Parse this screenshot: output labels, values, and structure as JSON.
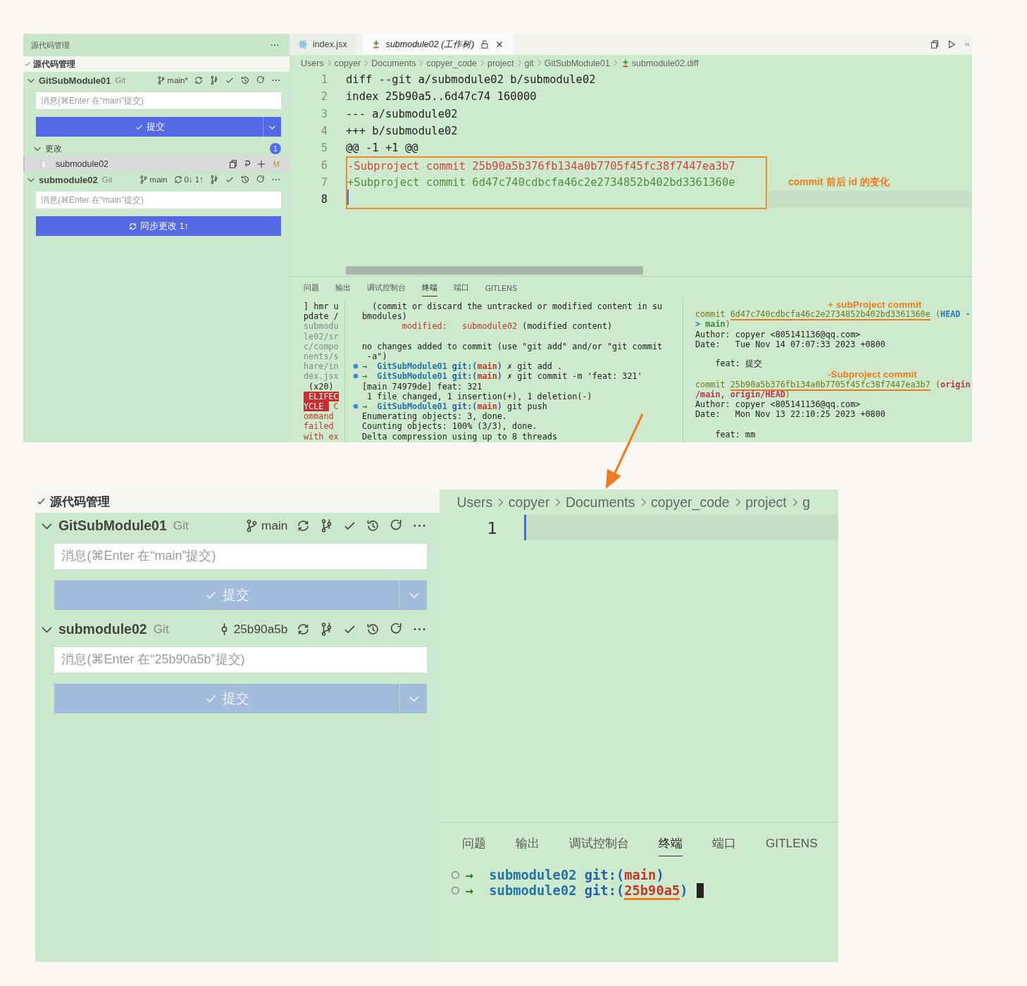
{
  "screens": [
    {
      "sidebar": {
        "title": "源代码管理",
        "section": "源代码管理",
        "repos": [
          {
            "name": "GitSubModule01",
            "provider": "Git",
            "kind": "branch",
            "ref": "main*",
            "placeholder": "消息(⌘Enter 在“main”提交)",
            "button": {
              "kind": "commit",
              "label": "提交",
              "disabled": false,
              "dropdown": true
            },
            "changes": {
              "label": "更改",
              "count": "1",
              "files": [
                {
                  "name": "submodule02",
                  "status": "M",
                  "selected": true
                }
              ]
            }
          },
          {
            "name": "submodule02",
            "provider": "Git",
            "kind": "branch",
            "ref": "main",
            "sync": "0↓ 1↑",
            "placeholder": "消息(⌘Enter 在“main”提交)",
            "button": {
              "kind": "sync",
              "label": "同步更改 1↑",
              "disabled": false,
              "dropdown": false
            }
          }
        ]
      },
      "editor": {
        "tabs": [
          {
            "label": "index.jsx",
            "selected": false,
            "preview": false
          },
          {
            "label": "submodule02 (工作树)",
            "selected": true,
            "preview": true
          }
        ],
        "breadcrumbs": [
          {
            "label": "Users",
            "kind": "folder"
          },
          {
            "label": "copyer",
            "kind": "folder"
          },
          {
            "label": "Documents",
            "kind": "folder"
          },
          {
            "label": "copyer_code",
            "kind": "folder"
          },
          {
            "label": "project",
            "kind": "folder"
          },
          {
            "label": "git",
            "kind": "folder"
          },
          {
            "label": "GitSubModule01",
            "kind": "folder"
          },
          {
            "label": "submodule02.diff",
            "kind": "file"
          }
        ],
        "lines": [
          {
            "number": "1",
            "kind": "context",
            "text": "diff --git a/submodule02 b/submodule02",
            "current": false,
            "boxed": false
          },
          {
            "number": "2",
            "kind": "context",
            "text": "index 25b90a5..6d47c74 160000",
            "current": false,
            "boxed": false
          },
          {
            "number": "3",
            "kind": "context",
            "text": "--- a/submodule02",
            "current": false,
            "boxed": false
          },
          {
            "number": "4",
            "kind": "context",
            "text": "+++ b/submodule02",
            "current": false,
            "boxed": false
          },
          {
            "number": "5",
            "kind": "context",
            "text": "@@ -1 +1 @@",
            "current": false,
            "boxed": false
          },
          {
            "number": "6",
            "kind": "removed",
            "text": "-Subproject commit 25b90a5b376fb134a0b7705f45fc38f7447ea3b7",
            "current": false,
            "boxed": true
          },
          {
            "number": "7",
            "kind": "added",
            "text": "+Subproject commit 6d47c740cdbcfa46c2e2734852b402bd3361360e",
            "current": false,
            "boxed": true,
            "note": "commit 前后 id 的变化"
          },
          {
            "number": "8",
            "kind": "context",
            "current": true,
            "boxed": true
          }
        ]
      },
      "panel": {
        "tabs": [
          {
            "label": "问题",
            "selected": false
          },
          {
            "label": "输出",
            "selected": false
          },
          {
            "label": "调试控制台",
            "selected": false
          },
          {
            "label": "终端",
            "selected": true
          },
          {
            "label": "端口",
            "selected": false
          },
          {
            "label": "GITLENS",
            "selected": false
          }
        ],
        "panes": [
          {
            "kind": "side",
            "lines": [
              {
                "kind": "text",
                "segments": [
                  {
                    "text": "] hmr u",
                    "kind": "plain"
                  }
                ]
              },
              {
                "kind": "text",
                "segments": [
                  {
                    "text": "pdate /",
                    "kind": "plain"
                  }
                ]
              },
              {
                "kind": "text",
                "segments": [
                  {
                    "text": "submodu",
                    "kind": "dim"
                  }
                ]
              },
              {
                "kind": "text",
                "segments": [
                  {
                    "text": "le02/sr",
                    "kind": "dim"
                  }
                ]
              },
              {
                "kind": "text",
                "segments": [
                  {
                    "text": "c/compo",
                    "kind": "dim"
                  }
                ]
              },
              {
                "kind": "text",
                "segments": [
                  {
                    "text": "nents/s",
                    "kind": "dim"
                  }
                ]
              },
              {
                "kind": "text",
                "segments": [
                  {
                    "text": "hare/in",
                    "kind": "dim"
                  }
                ]
              },
              {
                "kind": "text",
                "segments": [
                  {
                    "text": "dex.jsx",
                    "kind": "dim"
                  }
                ]
              },
              {
                "kind": "text",
                "segments": [
                  {
                    "text": " (x20)",
                    "kind": "plain"
                  }
                ]
              },
              {
                "kind": "text",
                "segments": [
                  {
                    "text": " ELIFEC",
                    "kind": "badge"
                  }
                ]
              },
              {
                "kind": "text",
                "segments": [
                  {
                    "text": "YCLE ",
                    "kind": "badge"
                  },
                  {
                    "text": " C",
                    "kind": "red"
                  }
                ]
              },
              {
                "kind": "text",
                "segments": [
                  {
                    "text": "ommand",
                    "kind": "red"
                  }
                ]
              },
              {
                "kind": "text",
                "segments": [
                  {
                    "text": "failed",
                    "kind": "red"
                  }
                ]
              },
              {
                "kind": "text",
                "segments": [
                  {
                    "text": "with ex",
                    "kind": "red"
                  }
                ]
              }
            ]
          },
          {
            "kind": "main",
            "lines": [
              {
                "kind": "text",
                "segments": [
                  {
                    "text": "  (commit or discard the untracked or modified content in su",
                    "kind": "plain"
                  }
                ]
              },
              {
                "kind": "text",
                "segments": [
                  {
                    "text": "bmodules)",
                    "kind": "plain"
                  }
                ]
              },
              {
                "kind": "text",
                "segments": [
                  {
                    "text": "        modified:   submodule02",
                    "kind": "red"
                  },
                  {
                    "text": " (modified content)",
                    "kind": "plain"
                  }
                ]
              },
              {
                "kind": "blank"
              },
              {
                "kind": "text",
                "segments": [
                  {
                    "text": "no changes added to commit (use \"git add\" and/or \"git commit",
                    "kind": "plain"
                  }
                ]
              },
              {
                "kind": "text",
                "segments": [
                  {
                    "text": " -a\")",
                    "kind": "plain"
                  }
                ]
              },
              {
                "kind": "prompt",
                "succeeded": true,
                "cursor": false,
                "segments": [
                  {
                    "text": "→  ",
                    "kind": "arrow"
                  },
                  {
                    "text": "GitSubModule01 ",
                    "kind": "dir"
                  },
                  {
                    "text": "git:(",
                    "kind": "git"
                  },
                  {
                    "text": "main",
                    "kind": "branch"
                  },
                  {
                    "text": ") ",
                    "kind": "git"
                  },
                  {
                    "text": "✗ git add .",
                    "kind": "plain"
                  }
                ]
              },
              {
                "kind": "prompt",
                "succeeded": true,
                "cursor": false,
                "segments": [
                  {
                    "text": "→  ",
                    "kind": "arrow"
                  },
                  {
                    "text": "GitSubModule01 ",
                    "kind": "dir"
                  },
                  {
                    "text": "git:(",
                    "kind": "git"
                  },
                  {
                    "text": "main",
                    "kind": "branch"
                  },
                  {
                    "text": ") ",
                    "kind": "git"
                  },
                  {
                    "text": "✗ git commit -m 'feat: 321'",
                    "kind": "plain"
                  }
                ]
              },
              {
                "kind": "text",
                "segments": [
                  {
                    "text": "[main 74979de] feat: 321",
                    "kind": "plain"
                  }
                ]
              },
              {
                "kind": "text",
                "segments": [
                  {
                    "text": " 1 file changed, 1 insertion(+), 1 deletion(-)",
                    "kind": "plain"
                  }
                ]
              },
              {
                "kind": "prompt",
                "succeeded": true,
                "cursor": false,
                "segments": [
                  {
                    "text": "→  ",
                    "kind": "arrow"
                  },
                  {
                    "text": "GitSubModule01 ",
                    "kind": "dir"
                  },
                  {
                    "text": "git:(",
                    "kind": "git"
                  },
                  {
                    "text": "main",
                    "kind": "branch"
                  },
                  {
                    "text": ") ",
                    "kind": "git"
                  },
                  {
                    "text": "git push",
                    "kind": "plain"
                  }
                ]
              },
              {
                "kind": "text",
                "segments": [
                  {
                    "text": "Enumerating objects: 3, done.",
                    "kind": "plain"
                  }
                ]
              },
              {
                "kind": "text",
                "segments": [
                  {
                    "text": "Counting objects: 100% (3/3), done.",
                    "kind": "plain"
                  }
                ]
              },
              {
                "kind": "text",
                "segments": [
                  {
                    "text": "Delta compression using up to 8 threads",
                    "kind": "plain"
                  }
                ]
              }
            ]
          },
          {
            "kind": "log",
            "lines": [
              {
                "kind": "note",
                "segments": [
                  {
                    "text": "+ subProject commit",
                    "kind": "note"
                  }
                ]
              },
              {
                "kind": "text",
                "segments": [
                  {
                    "text": "commit ",
                    "kind": "hash"
                  },
                  {
                    "text": "6d47c740cdbcfa46c2e2734852b402bd3361360e",
                    "kind": "hash",
                    "marked": true
                  },
                  {
                    "text": " (",
                    "kind": "hash"
                  },
                  {
                    "text": "HEAD -",
                    "kind": "head"
                  }
                ]
              },
              {
                "kind": "text",
                "segments": [
                  {
                    "text": "> ",
                    "kind": "head"
                  },
                  {
                    "text": "main",
                    "kind": "local"
                  },
                  {
                    "text": ")",
                    "kind": "hash"
                  }
                ]
              },
              {
                "kind": "text",
                "segments": [
                  {
                    "text": "Author: copyer <805141136@qq.com>",
                    "kind": "plain"
                  }
                ]
              },
              {
                "kind": "text",
                "segments": [
                  {
                    "text": "Date:   Tue Nov 14 07:07:33 2023 +0800",
                    "kind": "plain"
                  }
                ]
              },
              {
                "kind": "blank"
              },
              {
                "kind": "text",
                "segments": [
                  {
                    "text": "    feat: 提交",
                    "kind": "plain"
                  }
                ]
              },
              {
                "kind": "note",
                "segments": [
                  {
                    "text": "-Subproject commit",
                    "kind": "note"
                  }
                ]
              },
              {
                "kind": "text",
                "segments": [
                  {
                    "text": "commit ",
                    "kind": "hash"
                  },
                  {
                    "text": "25b90a5b376fb134a0b7705f45fc38f7447ea3b7",
                    "kind": "hash",
                    "marked": true
                  },
                  {
                    "text": " (",
                    "kind": "hash"
                  },
                  {
                    "text": "origin",
                    "kind": "remote"
                  }
                ]
              },
              {
                "kind": "text",
                "segments": [
                  {
                    "text": "/main, origin/HEAD",
                    "kind": "remote"
                  },
                  {
                    "text": ")",
                    "kind": "hash"
                  }
                ]
              },
              {
                "kind": "text",
                "segments": [
                  {
                    "text": "Author: copyer <805141136@qq.com>",
                    "kind": "plain"
                  }
                ]
              },
              {
                "kind": "text",
                "segments": [
                  {
                    "text": "Date:   Mon Nov 13 22:10:25 2023 +0800",
                    "kind": "plain"
                  }
                ]
              },
              {
                "kind": "blank"
              },
              {
                "kind": "text",
                "segments": [
                  {
                    "text": "    feat: mm",
                    "kind": "plain"
                  }
                ]
              }
            ]
          }
        ]
      }
    },
    {
      "sidebar": {
        "section": "源代码管理",
        "repos": [
          {
            "name": "GitSubModule01",
            "provider": "Git",
            "kind": "branch",
            "ref": "main",
            "placeholder": "消息(⌘Enter 在“main”提交)",
            "button": {
              "kind": "commit",
              "label": "提交",
              "disabled": true,
              "dropdown": true
            }
          },
          {
            "name": "submodule02",
            "provider": "Git",
            "kind": "commit",
            "ref": "25b90a5b",
            "placeholder": "消息(⌘Enter 在“25b90a5b”提交)",
            "button": {
              "kind": "commit",
              "label": "提交",
              "disabled": true,
              "dropdown": true
            }
          }
        ]
      },
      "editor": {
        "breadcrumbs": [
          {
            "label": "Users",
            "kind": "folder"
          },
          {
            "label": "copyer",
            "kind": "folder"
          },
          {
            "label": "Documents",
            "kind": "folder"
          },
          {
            "label": "copyer_code",
            "kind": "folder"
          },
          {
            "label": "project",
            "kind": "folder"
          },
          {
            "label": "g",
            "kind": "folder"
          }
        ],
        "lines": [
          {
            "number": "1",
            "kind": "context",
            "current": true,
            "boxed": false
          }
        ]
      },
      "panel": {
        "tabs": [
          {
            "label": "问题",
            "selected": false
          },
          {
            "label": "输出",
            "selected": false
          },
          {
            "label": "调试控制台",
            "selected": false
          },
          {
            "label": "终端",
            "selected": true
          },
          {
            "label": "端口",
            "selected": false
          },
          {
            "label": "GITLENS",
            "selected": false
          }
        ],
        "panes": [
          {
            "kind": "main",
            "lines": [
              {
                "kind": "prompt",
                "succeeded": false,
                "cursor": false,
                "segments": [
                  {
                    "text": "→  ",
                    "kind": "arrow"
                  },
                  {
                    "text": "submodule02 ",
                    "kind": "dir"
                  },
                  {
                    "text": "git:(",
                    "kind": "git"
                  },
                  {
                    "text": "main",
                    "kind": "branch"
                  },
                  {
                    "text": ")",
                    "kind": "git"
                  }
                ]
              },
              {
                "kind": "prompt",
                "succeeded": false,
                "cursor": true,
                "segments": [
                  {
                    "text": "→  ",
                    "kind": "arrow"
                  },
                  {
                    "text": "submodule02 ",
                    "kind": "dir"
                  },
                  {
                    "text": "git:(",
                    "kind": "git"
                  },
                  {
                    "text": "25b90a5",
                    "kind": "branch",
                    "marked": true
                  },
                  {
                    "text": ")",
                    "kind": "git"
                  }
                ]
              }
            ]
          }
        ]
      }
    }
  ]
}
